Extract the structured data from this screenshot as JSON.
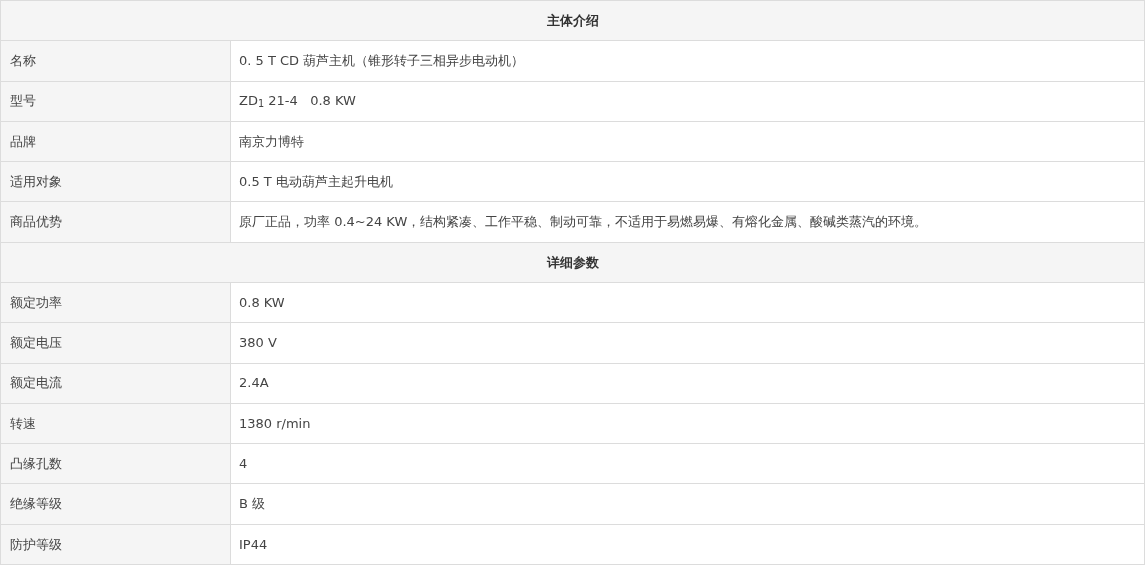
{
  "sections": [
    {
      "title": "主体介绍",
      "rows": [
        {
          "label": "名称",
          "value": "0. 5 T CD 葫芦主机（锥形转子三相异步电动机）"
        },
        {
          "label": "型号",
          "value": "ZD$_{1}$ 21-4   0.8 KW"
        },
        {
          "label": "品牌",
          "value": "南京力博特"
        },
        {
          "label": "适用对象",
          "value": "0.5 T 电动葫芦主起升电机"
        },
        {
          "label": "商品优势",
          "value": "原厂正品，功率 0.4~24 KW，结构紧凑、工作平稳、制动可靠，不适用于易燃易爆、有熔化金属、酸碱类蒸汽的环境。"
        }
      ]
    },
    {
      "title": "详细参数",
      "rows": [
        {
          "label": "额定功率",
          "value": "0.8 KW"
        },
        {
          "label": "额定电压",
          "value": "380 V"
        },
        {
          "label": "额定电流",
          "value": "2.4A"
        },
        {
          "label": "转速",
          "value": "1380 r/min"
        },
        {
          "label": "凸缘孔数",
          "value": "4"
        },
        {
          "label": "绝缘等级",
          "value": "B 级"
        },
        {
          "label": "防护等级",
          "value": "IP44"
        }
      ]
    }
  ]
}
